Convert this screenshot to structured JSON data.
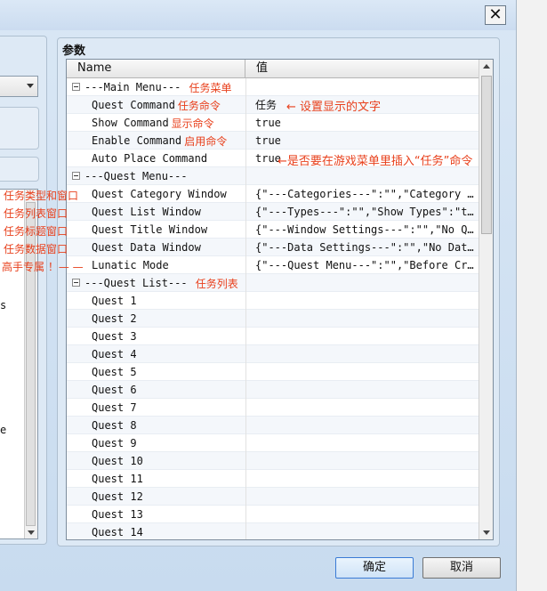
{
  "window": {
    "close_glyph": "✕"
  },
  "left_fragments": [
    "s",
    "e"
  ],
  "params": {
    "title": "参数",
    "col_name": "Name",
    "col_value": "值",
    "rows": [
      {
        "type": "cat",
        "name": "---Main Menu---",
        "value": "",
        "note": "任务菜单"
      },
      {
        "type": "item",
        "name": "Quest Command",
        "value": "任务",
        "note": "任务命令"
      },
      {
        "type": "item",
        "name": "Show Command",
        "value": "true",
        "note": "显示命令"
      },
      {
        "type": "item",
        "name": "Enable Command",
        "value": "true",
        "note": "启用命令"
      },
      {
        "type": "item",
        "name": "Auto Place Command",
        "value": "true",
        "note": ""
      },
      {
        "type": "cat",
        "name": "---Quest Menu---",
        "value": "",
        "note": ""
      },
      {
        "type": "item",
        "name": "Quest Category Window",
        "value": "{\"---Categories---\":\"\",\"Category O…",
        "note": ""
      },
      {
        "type": "item",
        "name": "Quest List Window",
        "value": "{\"---Types---\":\"\",\"Show Types\":\"tr…",
        "note": ""
      },
      {
        "type": "item",
        "name": "Quest Title Window",
        "value": "{\"---Window Settings---\":\"\",\"No Qu…",
        "note": ""
      },
      {
        "type": "item",
        "name": "Quest Data Window",
        "value": "{\"---Data Settings---\":\"\",\"No Data…",
        "note": ""
      },
      {
        "type": "item",
        "name": "Lunatic Mode",
        "value": "{\"---Quest Menu---\":\"\",\"Before Cre…",
        "note": ""
      },
      {
        "type": "cat",
        "name": "---Quest List---",
        "value": "",
        "note": "任务列表"
      },
      {
        "type": "item",
        "name": "Quest 1",
        "value": "",
        "note": ""
      },
      {
        "type": "item",
        "name": "Quest 2",
        "value": "",
        "note": ""
      },
      {
        "type": "item",
        "name": "Quest 3",
        "value": "",
        "note": ""
      },
      {
        "type": "item",
        "name": "Quest 4",
        "value": "",
        "note": ""
      },
      {
        "type": "item",
        "name": "Quest 5",
        "value": "",
        "note": ""
      },
      {
        "type": "item",
        "name": "Quest 6",
        "value": "",
        "note": ""
      },
      {
        "type": "item",
        "name": "Quest 7",
        "value": "",
        "note": ""
      },
      {
        "type": "item",
        "name": "Quest 8",
        "value": "",
        "note": ""
      },
      {
        "type": "item",
        "name": "Quest 9",
        "value": "",
        "note": ""
      },
      {
        "type": "item",
        "name": "Quest 10",
        "value": "",
        "note": ""
      },
      {
        "type": "item",
        "name": "Quest 11",
        "value": "",
        "note": ""
      },
      {
        "type": "item",
        "name": "Quest 12",
        "value": "",
        "note": ""
      },
      {
        "type": "item",
        "name": "Quest 13",
        "value": "",
        "note": ""
      },
      {
        "type": "item",
        "name": "Quest 14",
        "value": "",
        "note": ""
      }
    ]
  },
  "annotations": {
    "show_text": "← 设置显示的文字",
    "auto_place": "←是否要在游戏菜单里插入“任务”命令",
    "category_window": "任务类型和窗口",
    "list_window": "任务列表窗口",
    "title_window": "任务标题窗口",
    "data_window": "任务数据窗口",
    "lunatic": "高手专属 ！— —"
  },
  "buttons": {
    "ok": "确定",
    "cancel": "取消"
  },
  "colors": {
    "annotation": "#e8401c",
    "accent": "#3a7bd5"
  }
}
